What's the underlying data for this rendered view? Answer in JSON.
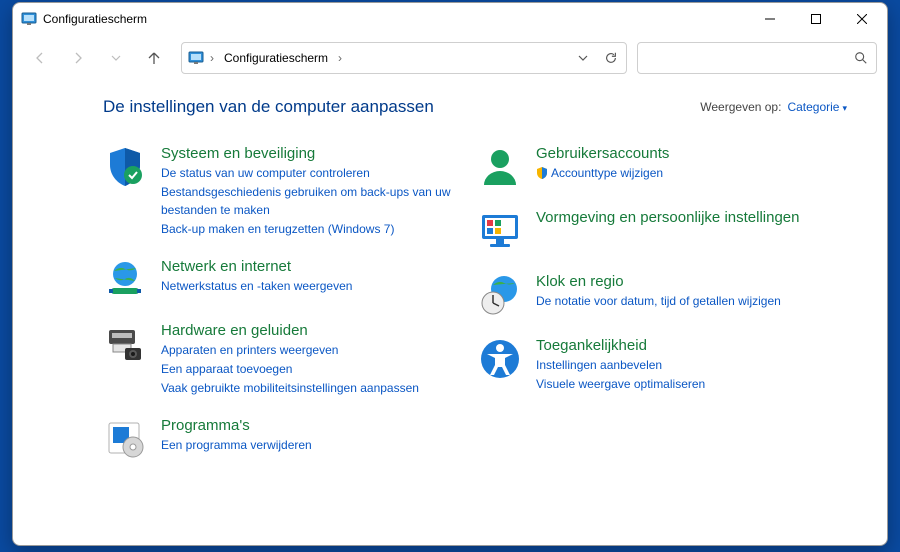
{
  "window": {
    "title": "Configuratiescherm"
  },
  "address": {
    "crumb": "Configuratiescherm"
  },
  "view": {
    "label": "Weergeven op:",
    "value": "Categorie"
  },
  "page": {
    "title": "De instellingen van de computer aanpassen"
  },
  "left": {
    "c0": {
      "title": "Systeem en beveiliging",
      "l0": "De status van uw computer controleren",
      "l1": "Bestandsgeschiedenis gebruiken om back-ups van uw bestanden te maken",
      "l2": "Back-up maken en terugzetten (Windows 7)"
    },
    "c1": {
      "title": "Netwerk en internet",
      "l0": "Netwerkstatus en -taken weergeven"
    },
    "c2": {
      "title": "Hardware en geluiden",
      "l0": "Apparaten en printers weergeven",
      "l1": "Een apparaat toevoegen",
      "l2": "Vaak gebruikte mobiliteitsinstellingen aanpassen"
    },
    "c3": {
      "title": "Programma's",
      "l0": "Een programma verwijderen"
    }
  },
  "right": {
    "c0": {
      "title": "Gebruikersaccounts",
      "l0": "Accounttype wijzigen"
    },
    "c1": {
      "title": "Vormgeving en persoonlijke instellingen"
    },
    "c2": {
      "title": "Klok en regio",
      "l0": "De notatie voor datum, tijd of getallen wijzigen"
    },
    "c3": {
      "title": "Toegankelijkheid",
      "l0": "Instellingen aanbevelen",
      "l1": "Visuele weergave optimaliseren"
    }
  }
}
